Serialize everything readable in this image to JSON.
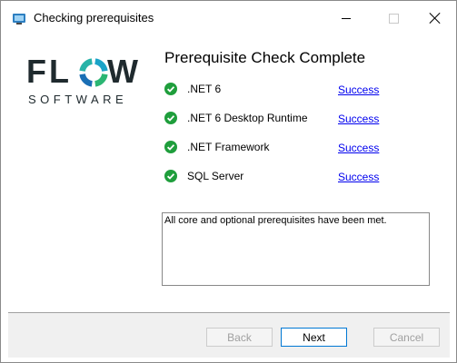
{
  "window": {
    "title": "Checking prerequisites",
    "app_icon": "installer-icon",
    "controls": [
      "minimize-icon",
      "maximize-icon",
      "close-icon"
    ]
  },
  "logo": {
    "word_pre": "FL",
    "word_post": "W",
    "subtitle": "SOFTWARE",
    "ring_colors": [
      "#1aa3c8",
      "#2bb673",
      "#1a6fb5",
      "#27b3a8"
    ]
  },
  "main": {
    "heading": "Prerequisite Check Complete",
    "status_icon": "check-circle-icon",
    "status_color": "#1f9e3c",
    "prerequisites": [
      {
        "name": ".NET 6",
        "status": "Success"
      },
      {
        "name": ".NET 6 Desktop Runtime",
        "status": "Success"
      },
      {
        "name": ".NET Framework",
        "status": "Success"
      },
      {
        "name": "SQL Server",
        "status": "Success"
      }
    ],
    "message": "All core and optional prerequisites have been met."
  },
  "footer": {
    "back_label": "Back",
    "next_label": "Next",
    "cancel_label": "Cancel"
  }
}
